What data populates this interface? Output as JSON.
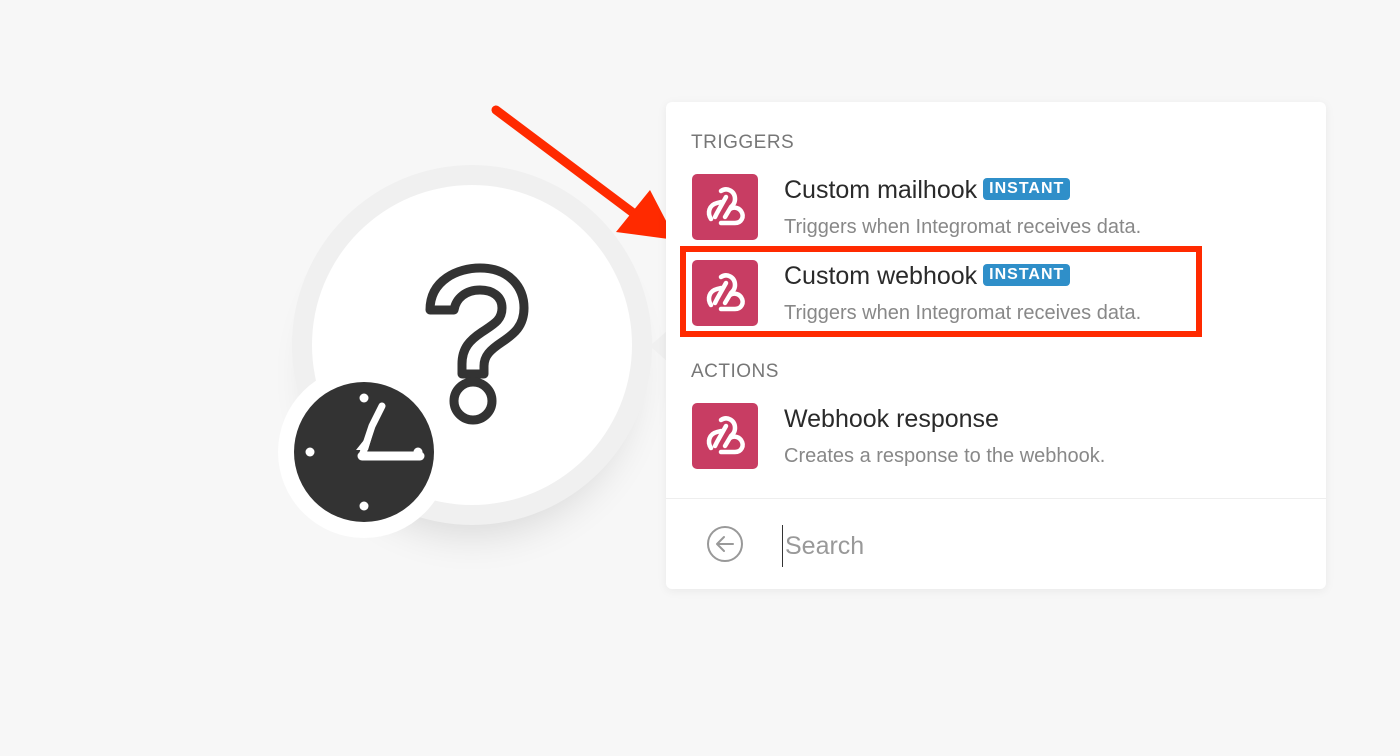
{
  "panel": {
    "triggers_title": "TRIGGERS",
    "actions_title": "ACTIONS",
    "triggers": [
      {
        "title": "Custom mailhook",
        "badge": "INSTANT",
        "description": "Triggers when Integromat receives data.",
        "icon": "webhook-icon"
      },
      {
        "title": "Custom webhook",
        "badge": "INSTANT",
        "description": "Triggers when Integromat receives data.",
        "icon": "webhook-icon"
      }
    ],
    "actions": [
      {
        "title": "Webhook response",
        "description": "Creates a response to the webhook.",
        "icon": "webhook-icon"
      }
    ],
    "search": {
      "placeholder": "Search",
      "value": ""
    }
  },
  "colors": {
    "icon_bg": "#c83d63",
    "badge_bg": "#2f8fc9",
    "highlight": "#ff2a00",
    "arrow": "#ff2a00",
    "clock": "#333333"
  },
  "module": {
    "icons": [
      "question-mark-icon",
      "clock-icon"
    ]
  }
}
